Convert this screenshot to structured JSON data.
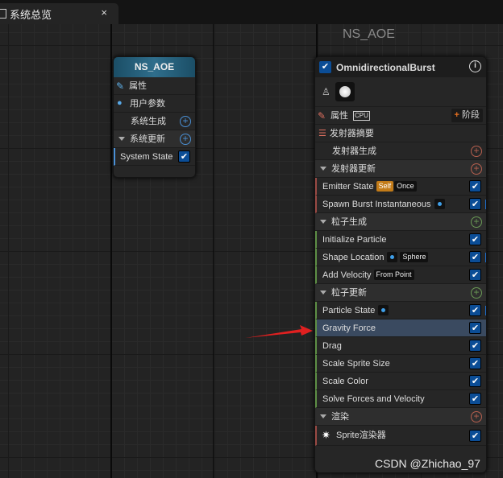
{
  "window": {
    "tab_title": "系统总览",
    "close": "×"
  },
  "ghost_label": "NS_AOE",
  "node_system": {
    "title": "NS_AOE",
    "rows": {
      "properties": "属性",
      "user_params": "用户参数",
      "spawn": "系统生成",
      "update": "系统更新",
      "system_state": "System State"
    }
  },
  "node_emitter": {
    "title": "OmnidirectionalBurst",
    "info": "i",
    "props_label": "属性",
    "cpu_label": "CPU",
    "stage_label": "阶段",
    "summary": "发射器摘要",
    "emitter_spawn": "发射器生成",
    "emitter_update": "发射器更新",
    "emitter_state": "Emitter State",
    "self_tag": "Self",
    "once_tag": "Once",
    "spawn_burst": "Spawn Burst Instantaneous",
    "particle_spawn": "粒子生成",
    "init_particle": "Initialize Particle",
    "shape_location": "Shape Location",
    "sphere_tag": "Sphere",
    "add_velocity": "Add Velocity",
    "from_point_tag": "From Point",
    "particle_update": "粒子更新",
    "particle_state": "Particle State",
    "gravity": "Gravity Force",
    "drag": "Drag",
    "scale_sprite": "Scale Sprite Size",
    "scale_color": "Scale Color",
    "solve_forces": "Solve Forces and Velocity",
    "render": "渲染",
    "sprite_renderer": "Sprite渲染器"
  },
  "watermark": "CSDN @Zhichao_97",
  "colors": {
    "header_blue": "#2f6e8c",
    "highlight": "#3a4a60",
    "check": "#0b4d96",
    "arrow": "#e02020"
  }
}
